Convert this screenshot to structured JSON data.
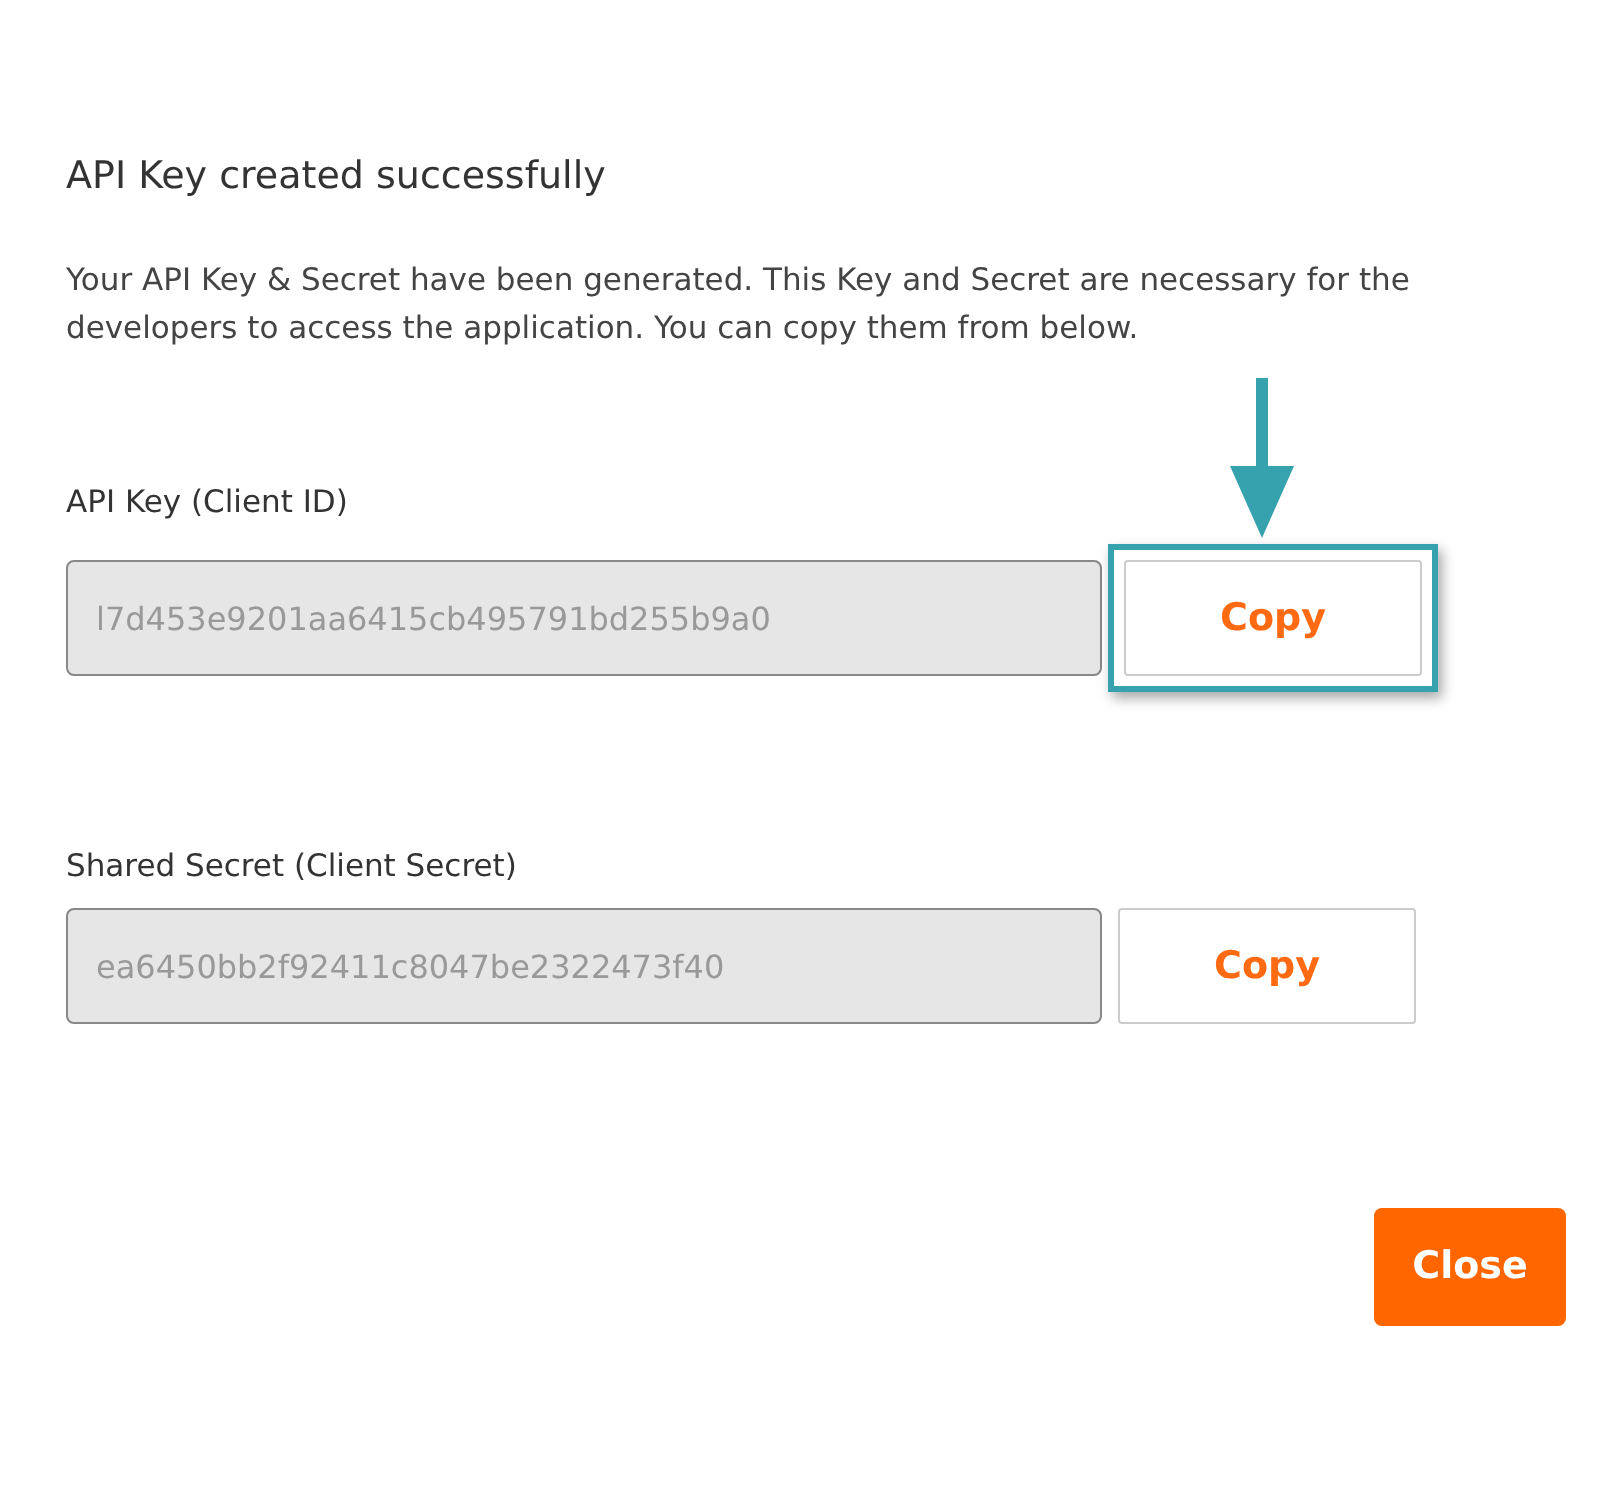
{
  "dialog": {
    "title": "API Key created successfully",
    "message": "Your API Key & Secret have been generated. This Key and Secret are necessary for the developers to access the application. You can copy them from below.",
    "fields": [
      {
        "label": "API Key (Client ID)",
        "value": "l7d453e9201aa6415cb495791bd255b9a0",
        "button": "Copy",
        "highlighted": true
      },
      {
        "label": "Shared Secret (Client Secret)",
        "value": "ea6450bb2f92411c8047be2322473f40",
        "button": "Copy",
        "highlighted": false
      }
    ],
    "close_button": "Close"
  }
}
